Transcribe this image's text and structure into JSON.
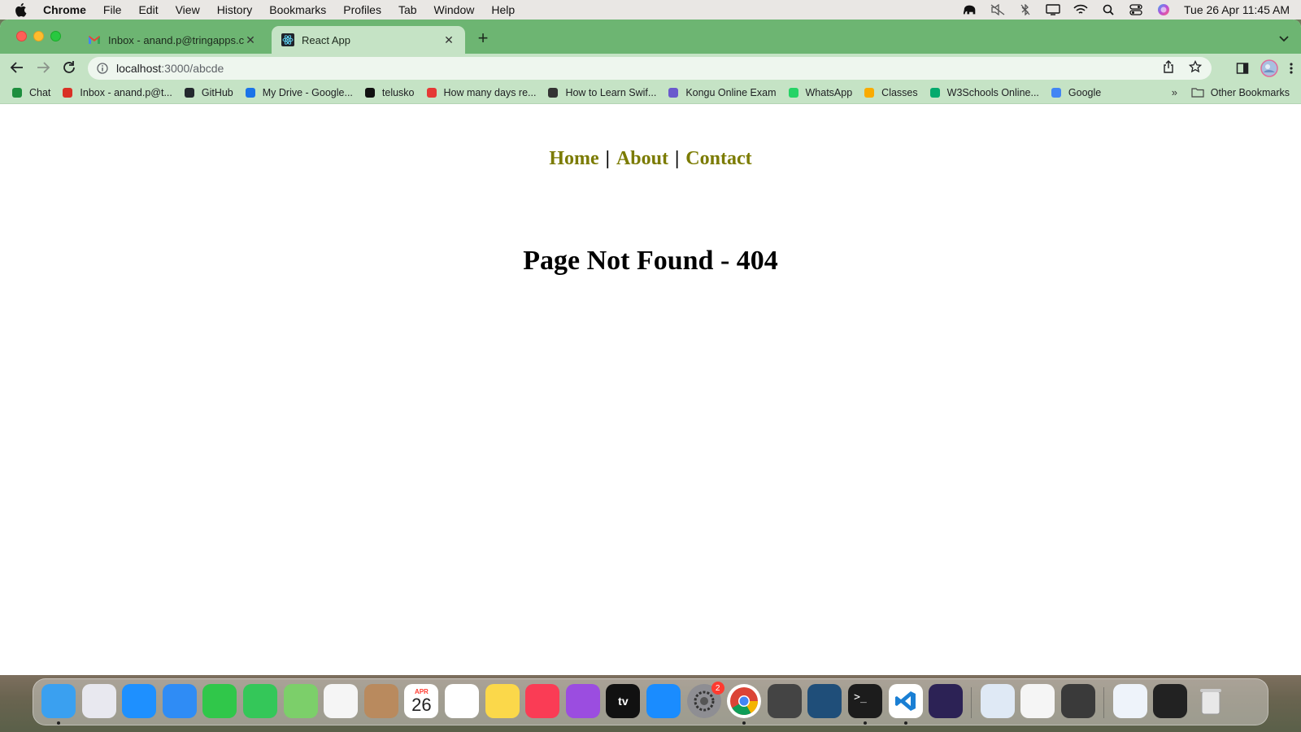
{
  "menubar": {
    "app_name": "Chrome",
    "items": [
      "File",
      "Edit",
      "View",
      "History",
      "Bookmarks",
      "Profiles",
      "Tab",
      "Window",
      "Help"
    ],
    "clock": "Tue 26 Apr  11:45 AM"
  },
  "tabs": [
    {
      "title": "Inbox - anand.p@tringapps.com",
      "favicon": "gmail-icon",
      "active": false
    },
    {
      "title": "React App",
      "favicon": "react-icon",
      "active": true
    }
  ],
  "address_bar": {
    "host": "localhost",
    "path": ":3000/abcde"
  },
  "bookmarks": [
    {
      "label": "Chat",
      "icon": "chat-icon",
      "color": "#1e8e3e"
    },
    {
      "label": "Inbox - anand.p@t...",
      "icon": "gmail-icon",
      "color": "#d93025"
    },
    {
      "label": "GitHub",
      "icon": "github-icon",
      "color": "#24292e"
    },
    {
      "label": "My Drive - Google...",
      "icon": "drive-icon",
      "color": "#1a73e8"
    },
    {
      "label": "telusko",
      "icon": "telusko-icon",
      "color": "#111111"
    },
    {
      "label": "How many days re...",
      "icon": "shield-icon",
      "color": "#e53935"
    },
    {
      "label": "How to Learn Swif...",
      "icon": "swift-icon",
      "color": "#333333"
    },
    {
      "label": "Kongu Online Exam",
      "icon": "kongu-icon",
      "color": "#6a5acd"
    },
    {
      "label": "WhatsApp",
      "icon": "whatsapp-icon",
      "color": "#25d366"
    },
    {
      "label": "Classes",
      "icon": "classroom-icon",
      "color": "#f9ab00"
    },
    {
      "label": "W3Schools Online...",
      "icon": "w3schools-icon",
      "color": "#04aa6d"
    },
    {
      "label": "Google",
      "icon": "google-icon",
      "color": "#4285f4"
    }
  ],
  "bookmarks_more": "»",
  "other_bookmarks": "Other Bookmarks",
  "page": {
    "nav": [
      {
        "label": "Home"
      },
      {
        "label": "About"
      },
      {
        "label": "Contact"
      }
    ],
    "separator": "|",
    "heading": "Page Not Found - 404"
  },
  "dock": {
    "apps": [
      "finder-icon",
      "launchpad-icon",
      "safari-icon",
      "mail-icon",
      "facetime-icon",
      "messages-icon",
      "maps-icon",
      "photos-icon",
      "contacts-icon",
      "calendar-icon",
      "reminders-icon",
      "notes-icon",
      "music-icon",
      "podcasts-icon",
      "appletv-icon",
      "appstore-icon",
      "system-preferences-icon",
      "chrome-icon",
      "keychain-icon",
      "mysql-workbench-icon",
      "terminal-icon",
      "vscode-icon",
      "eclipse-icon",
      "preview-icon",
      "textedit-icon",
      "calculator-icon",
      "document-icon",
      "screen-icon",
      "trash-icon"
    ],
    "calendar_month": "APR",
    "calendar_day": "26",
    "settings_badge": "2",
    "appletv_label": "tv"
  },
  "colors": {
    "tab_strip": "#6db572",
    "toolbar": "#c5e3c5",
    "nav_link": "#7b7b00"
  }
}
